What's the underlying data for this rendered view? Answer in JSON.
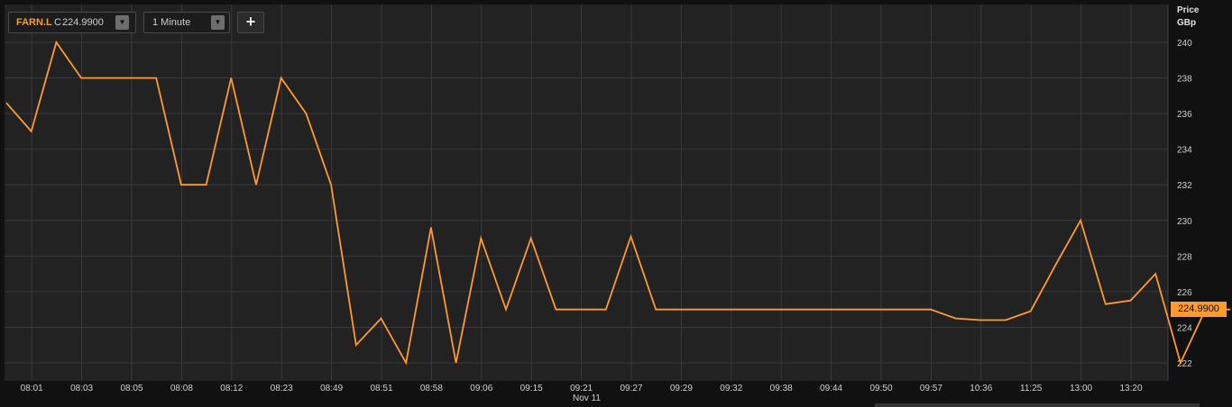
{
  "toolbar": {
    "symbol": "FARN.L",
    "close_prefix": "C",
    "close_value": "224.9900",
    "interval": "1 Minute",
    "dropdown_glyph": "▼",
    "add_glyph": "+"
  },
  "colors": {
    "background": "#111111",
    "plot_background": "#222222",
    "grid": "#3a3a3a",
    "line": "#ff9a2e",
    "text": "#d0d0d0"
  },
  "chart_data": {
    "type": "line",
    "title": "",
    "ylabel": [
      "Price",
      "GBp"
    ],
    "ylim": [
      221,
      241
    ],
    "yticks": [
      222,
      224,
      226,
      228,
      230,
      232,
      234,
      236,
      238,
      240
    ],
    "grid": true,
    "x_tick_labels": [
      "08:01",
      "08:03",
      "08:05",
      "08:08",
      "08:12",
      "08:23",
      "08:49",
      "08:51",
      "08:58",
      "09:06",
      "09:15",
      "09:21",
      "09:27",
      "09:29",
      "09:32",
      "09:38",
      "09:44",
      "09:50",
      "09:57",
      "10:36",
      "11:25",
      "13:00",
      "13:20"
    ],
    "date_label": "Nov 11",
    "last_price": "224.9900",
    "series": [
      {
        "values": [
          236.6,
          235,
          240,
          238,
          238,
          238,
          238,
          232,
          232,
          238,
          232,
          238,
          236,
          232,
          223,
          224.5,
          222,
          229.6,
          222,
          229,
          225,
          229,
          225,
          225,
          225,
          229.1,
          225,
          225,
          225,
          225,
          225,
          225,
          225,
          225,
          225,
          225,
          225,
          225,
          224.5,
          224.4,
          224.4,
          224.9,
          227.5,
          230,
          225.3,
          225.5,
          227,
          222,
          225,
          225
        ]
      }
    ]
  }
}
